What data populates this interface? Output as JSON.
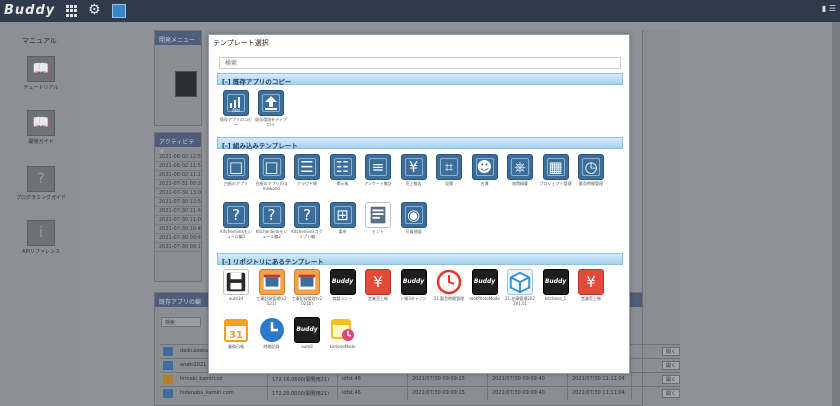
{
  "app": {
    "logo": "Buddy",
    "user_text": "▮ ☰"
  },
  "sidebar": {
    "title": "マニュアル",
    "items": [
      {
        "label": "チュートリアル",
        "icon": "book-open-icon"
      },
      {
        "label": "開発ガイド",
        "icon": "book-open-icon"
      },
      {
        "label": "プログラミングガイド",
        "icon": "question-icon"
      },
      {
        "label": "APIリファレンス",
        "icon": "info-icon"
      }
    ]
  },
  "background": {
    "dev_menu_title": "開発メニュー",
    "activity_title": "アクティビティ",
    "activity_rows": [
      "2021-08-02 12:54",
      "2021-08-02 11:58",
      "2021-08-02 11:14",
      "2021-07-31 08:26",
      "2021-07-30 13:03",
      "2021-07-30 12:52",
      "2021-07-30 11:47",
      "2021-07-30 11:02",
      "2021-07-30 10:41",
      "2021-07-30 09:42",
      "2021-07-30 09:18"
    ],
    "existing_apps_title": "既存アプリの編",
    "search_placeholder": "検索",
    "table_rows": [
      {
        "name": "daiki.ozaka",
        "ip": "",
        "env": "",
        "created": "",
        "updated": "",
        "mod": "",
        "button": "開く"
      },
      {
        "name": "anaki2021",
        "ip": "",
        "env": "",
        "created": "",
        "updated": "",
        "mod": "",
        "button": "開く"
      },
      {
        "name": "hiroaki_kamiri.co",
        "ip": "172.16.0600(開発用21)",
        "env": "idfst.46",
        "created": "2021/07/30 09:09:15",
        "updated": "2021/07/30 09:09:40",
        "mod": "2021/07/30 11:11:04",
        "button": "開く"
      },
      {
        "name": "hidenobu_kamiri.com",
        "ip": "172.20.0000(開発用21)",
        "env": "idfst.46",
        "created": "2021/07/30 09:09:15",
        "updated": "2021/07/30 09:09:40",
        "mod": "2021/07/30 11:11:04",
        "button": "開く"
      }
    ]
  },
  "modal": {
    "title": "テンプレート選択",
    "search_placeholder": "検索",
    "sections": [
      {
        "label": "[-] 既存アプリのコピー",
        "tiles": [
          {
            "label": "既存アプリのコピー",
            "icon": "app-copy-icon",
            "glyph": "↑",
            "style": "blue"
          },
          {
            "label": "既存環境をディプロイ",
            "icon": "upload-icon",
            "glyph": "⇧",
            "style": "blue"
          }
        ]
      },
      {
        "label": "[-] 組み込みテンプレート",
        "tiles": [
          {
            "label": "白紙のアプリ",
            "icon": "blank-doc-icon",
            "glyph": "□",
            "style": "blue"
          },
          {
            "label": "白紙のアプリ(Framework)",
            "icon": "blank-doc-icon",
            "glyph": "□",
            "style": "blue"
          },
          {
            "label": "クラウド帳",
            "icon": "notebook-icon",
            "glyph": "☰",
            "style": "blue"
          },
          {
            "label": "掲示板",
            "icon": "board-icon",
            "glyph": "☷",
            "style": "blue"
          },
          {
            "label": "アンケート集計",
            "icon": "list-icon",
            "glyph": "≡",
            "style": "blue"
          },
          {
            "label": "売上報告",
            "icon": "yen-icon",
            "glyph": "¥",
            "style": "blue"
          },
          {
            "label": "見積",
            "icon": "calculator-icon",
            "glyph": "⌗",
            "style": "blue"
          },
          {
            "label": "名簿",
            "icon": "people-icon",
            "glyph": "☻",
            "style": "blue"
          },
          {
            "label": "旅費精算",
            "icon": "train-icon",
            "glyph": "⎈",
            "style": "blue"
          },
          {
            "label": "プロジェクト管理",
            "icon": "calendar-icon",
            "glyph": "▦",
            "style": "blue"
          },
          {
            "label": "勤怠時間管理",
            "icon": "clock-icon",
            "glyph": "◷",
            "style": "blue"
          },
          {
            "label": "KitchenSinkモジュール編1",
            "icon": "question-icon",
            "glyph": "?",
            "style": "blue"
          },
          {
            "label": "KitchenSinkモジュール編2",
            "icon": "question-icon",
            "glyph": "?",
            "style": "blue"
          },
          {
            "label": "KitchenSinkスクリプト編",
            "icon": "question-icon",
            "glyph": "?",
            "style": "blue"
          },
          {
            "label": "電卓",
            "icon": "grid-app-icon",
            "glyph": "⊞",
            "style": "blue"
          },
          {
            "label": "ヒント",
            "icon": "hint-icon",
            "glyph": "⎔",
            "style": "white"
          },
          {
            "label": "写真地図",
            "icon": "map-pin-icon",
            "glyph": "◉",
            "style": "blue"
          }
        ]
      },
      {
        "label": "[-] リポジトリにあるテンプレート",
        "tiles": [
          {
            "label": "auto1d",
            "icon": "floppy-disk-icon",
            "glyph": "▣",
            "style": "white"
          },
          {
            "label": "工事記録管理(v2021)",
            "icon": "construction-record-icon",
            "glyph": "▤",
            "style": "orange"
          },
          {
            "label": "工事記録管理(v2021b)",
            "icon": "construction-record-icon",
            "glyph": "▤",
            "style": "orange"
          },
          {
            "label": "商談ミント",
            "icon": "buddy-logo-icon",
            "glyph": "Buddy",
            "style": "black"
          },
          {
            "label": "営業売上帳",
            "icon": "yen-icon",
            "glyph": "¥",
            "style": "red"
          },
          {
            "label": "ト帳3キャノン",
            "icon": "buddy-logo-icon",
            "glyph": "Buddy",
            "style": "black"
          },
          {
            "label": "21.勤怠時間管理",
            "icon": "clock-icon",
            "glyph": "◷",
            "style": "red-clock"
          },
          {
            "label": "rootPhotoMode",
            "icon": "buddy-logo-icon",
            "glyph": "Buddy",
            "style": "black"
          },
          {
            "label": "21.在庫管理2021V1.01",
            "icon": "box-icon",
            "glyph": "⬡",
            "style": "sky"
          },
          {
            "label": "kitchens_1",
            "icon": "buddy-logo-icon",
            "glyph": "Buddy",
            "style": "black"
          },
          {
            "label": "営業売上帳",
            "icon": "yen-icon",
            "glyph": "¥",
            "style": "red"
          },
          {
            "label": "業務日報",
            "icon": "calendar-31-icon",
            "glyph": "31",
            "style": "cal"
          },
          {
            "label": "時間記録",
            "icon": "clock-icon",
            "glyph": "◷",
            "style": "blue-clock"
          },
          {
            "label": "auto8",
            "icon": "buddy-logo-icon",
            "glyph": "Buddy",
            "style": "black"
          },
          {
            "label": "kintoneMode",
            "icon": "calendar-clock-icon",
            "glyph": "◷",
            "style": "cal2"
          }
        ]
      }
    ]
  }
}
